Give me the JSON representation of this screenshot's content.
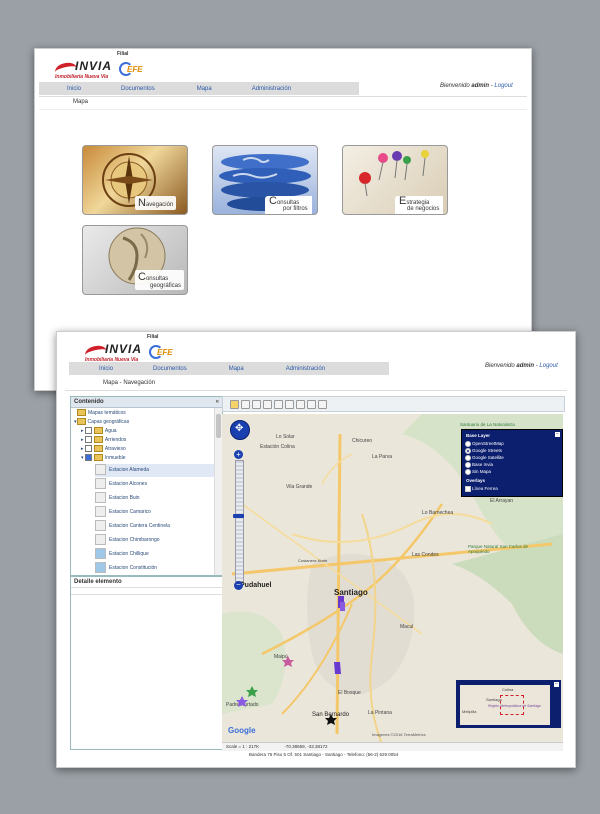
{
  "brand": {
    "name": "INVIA",
    "subtitle": "Inmobiliaria Nueva Via",
    "filial_label": "Filial",
    "efe": "EFE"
  },
  "welcome": {
    "prefix": "Bienvenido",
    "user": "admin",
    "separator": "-",
    "logout": "Logout"
  },
  "menu": [
    "Inicio",
    "Documentos",
    "Mapa",
    "Administración"
  ],
  "screen1": {
    "breadcrumb": "Mapa",
    "tiles": [
      {
        "initial": "N",
        "rest": "avegación",
        "sub": ""
      },
      {
        "initial": "C",
        "rest": "onsultas",
        "sub": "por filtros"
      },
      {
        "initial": "E",
        "rest": "strategia",
        "sub": "de negocios"
      },
      {
        "initial": "C",
        "rest": "onsultas",
        "sub": "geográficas"
      }
    ]
  },
  "screen2": {
    "breadcrumb": "Mapa - Navegación",
    "contenido_title": "Contenido",
    "tree": {
      "mapas_tematicos": "Mapas temáticos",
      "capas_geograficas": "Capas geográficas",
      "groups": [
        "Agua",
        "Arriendos",
        "Atravieso",
        "Inmueble"
      ],
      "layers": [
        "Estacion Alameda",
        "Estacion Alcones",
        "Estacion Buin",
        "Estacion Camarico",
        "Estacion Cantera Centinela",
        "Estacion Chimbarongo",
        "Estacion Chillique",
        "Estacion Constitución"
      ]
    },
    "detalle_title": "Detalle elemento",
    "baselayer": {
      "title": "Base Layer",
      "options": [
        "OpenStreetMap",
        "Google Streets",
        "Google Satellite",
        "Base Invia",
        "Sin Mapa"
      ],
      "overlays_title": "Overlays",
      "overlays": [
        "Línea Ferrea"
      ]
    },
    "map_labels": {
      "santiago": "Santiago",
      "pudahuel": "Pudahuel",
      "lo_solar": "Lo Solar",
      "estacion_colina": "Estación Colina",
      "chicureo": "Chicureo",
      "la_parva": "La Parva",
      "vila_grande": "Vila Grande",
      "las_condes": "Las Condes",
      "macul": "Macul",
      "maipu": "Maipú",
      "el_bosque": "El Bosque",
      "la_pintana": "La Pintana",
      "san_bernardo": "San Bernardo",
      "padre_hurtado": "Padre Hurtado",
      "lo_barnechea": "Lo Barnechea",
      "santuario": "Santuario de La Naturaleza",
      "parque": "Parque Natural San Carlos de Apoquindo",
      "el_arrayan": "El Arrayan",
      "costanera": "Costanera Norte",
      "google": "Google",
      "imagery": "Imágenes ©2016 TerraMetrics",
      "overview_santiago": "Santiago",
      "overview_region": "Región Metropolitana de Santiago",
      "overview_colina": "Colina",
      "overview_melipilla": "Melipilla"
    },
    "status": {
      "scale": "Scale = 1 : 217K",
      "coords": "-70.38659, -33.38172"
    },
    "footer": "Bandera 76 Piso 5 Of. 501 Santiago - Santiago - Telefono: (56-2) 629 0054"
  }
}
